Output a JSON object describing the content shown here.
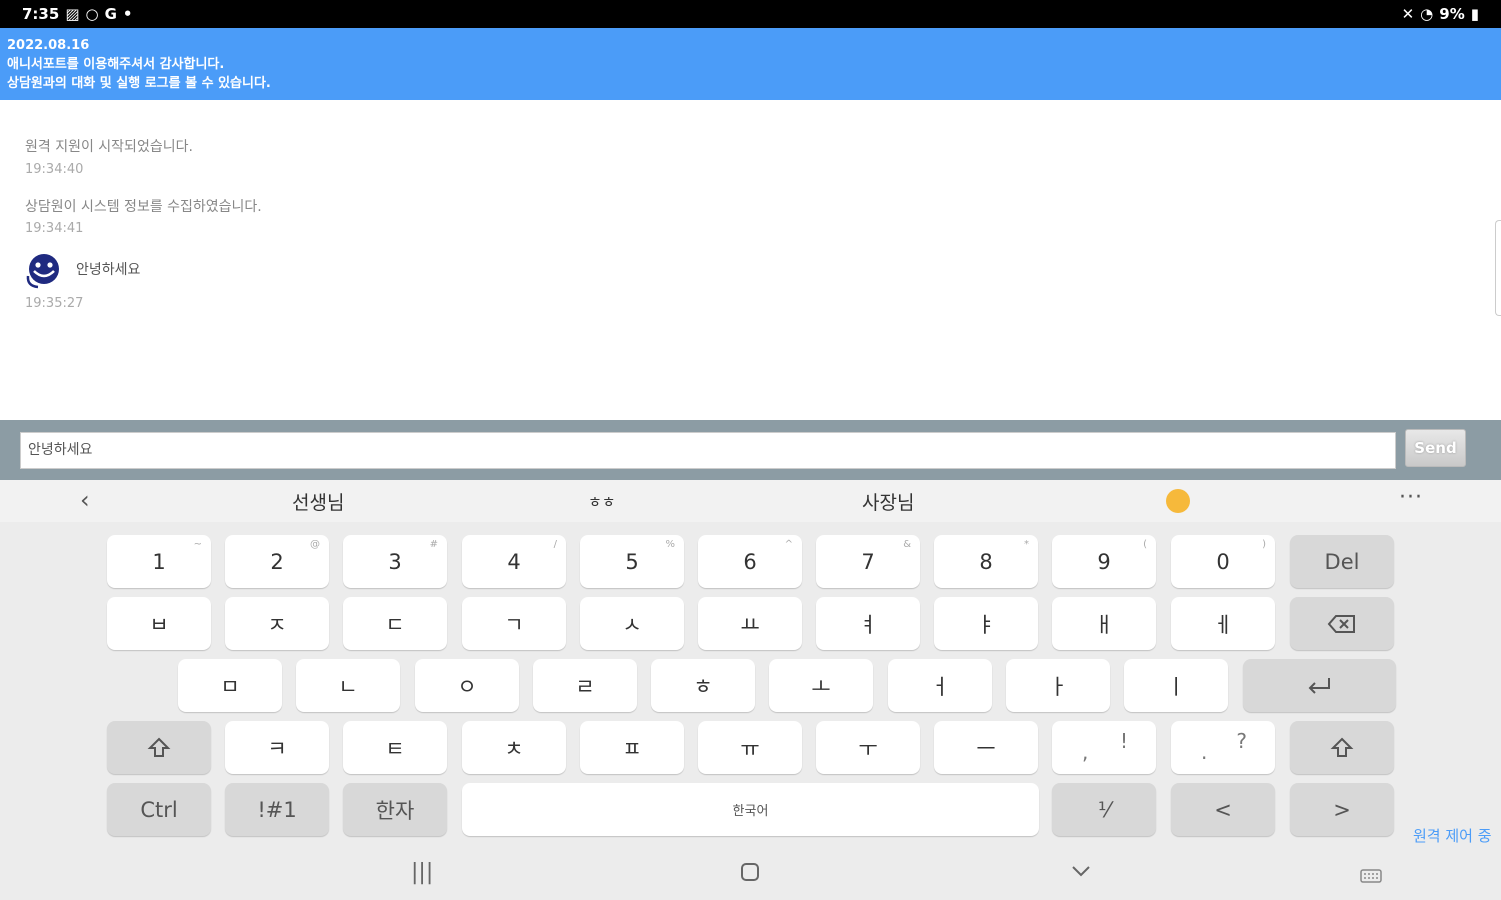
{
  "status_bar": {
    "time": "7:35",
    "left_icons": [
      "gallery-icon",
      "circle-icon",
      "G",
      "•"
    ],
    "right_text": "9%"
  },
  "banner": {
    "date": "2022.08.16",
    "line1": "애니서포트를 이용해주셔서 감사합니다.",
    "line2": "상담원과의 대화 및 실행 로그를 볼 수 있습니다."
  },
  "log": {
    "entries": [
      {
        "text": "원격 지원이 시작되었습니다.",
        "time": "19:34:40"
      },
      {
        "text": "상담원이 시스템 정보를 수집하였습니다.",
        "time": "19:34:41"
      },
      {
        "text": "안녕하세요",
        "time": "19:35:27"
      }
    ]
  },
  "input": {
    "value": "안녕하세요",
    "send_label": "Send"
  },
  "suggestions": {
    "items": [
      "선생님",
      "ㅎㅎ",
      "사장님"
    ],
    "emoji": "😩",
    "more": "···"
  },
  "keyboard": {
    "row1": [
      {
        "label": "1",
        "hint": "~"
      },
      {
        "label": "2",
        "hint": "@"
      },
      {
        "label": "3",
        "hint": "#"
      },
      {
        "label": "4",
        "hint": "/"
      },
      {
        "label": "5",
        "hint": "%"
      },
      {
        "label": "6",
        "hint": "^"
      },
      {
        "label": "7",
        "hint": "&"
      },
      {
        "label": "8",
        "hint": "*"
      },
      {
        "label": "9",
        "hint": "("
      },
      {
        "label": "0",
        "hint": ")"
      },
      {
        "label": "Del",
        "hint": ""
      }
    ],
    "row2": [
      "ㅂ",
      "ㅈ",
      "ㄷ",
      "ㄱ",
      "ㅅ",
      "ㅛ",
      "ㅕ",
      "ㅑ",
      "ㅐ",
      "ㅔ"
    ],
    "row3": [
      "ㅁ",
      "ㄴ",
      "ㅇ",
      "ㄹ",
      "ㅎ",
      "ㅗ",
      "ㅓ",
      "ㅏ",
      "ㅣ"
    ],
    "row4": [
      "ㅋ",
      "ㅌ",
      "ㅊ",
      "ㅍ",
      "ㅠ",
      "ㅜ",
      "ㅡ"
    ],
    "comma": {
      "main": ",",
      "hint": "!"
    },
    "period": {
      "main": ".",
      "hint": "?"
    },
    "ctrl": "Ctrl",
    "symbols": "!#1",
    "hanja": "한자",
    "space": "한국어",
    "fraction": "⅟",
    "left": "<",
    "right": ">"
  },
  "corner_text": "원격 제어 중"
}
